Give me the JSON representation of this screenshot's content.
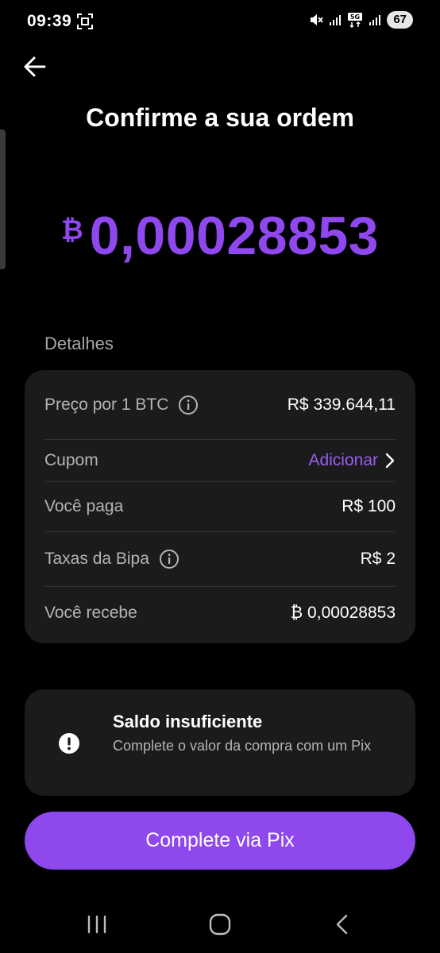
{
  "status_bar": {
    "time": "09:39",
    "battery": "67",
    "icons": [
      "screenshot-icon",
      "mute-icon",
      "signal-icon",
      "5g-icon",
      "signal-icon"
    ]
  },
  "header": {
    "back_icon": "arrow-left-icon",
    "title": "Confirme a sua ordem"
  },
  "amount": {
    "symbol": "₿",
    "value": "0,00028853"
  },
  "details": {
    "section_label": "Detalhes",
    "rows": [
      {
        "label": "Preço por 1 BTC",
        "value": "R$ 339.644,11",
        "has_info": true
      },
      {
        "label": "Cupom",
        "value": "Adicionar",
        "is_link": true
      },
      {
        "label": "Você paga",
        "value": "R$ 100"
      },
      {
        "label": "Taxas da Bipa",
        "value": "R$ 2",
        "has_info": true
      },
      {
        "label": "Você recebe",
        "value": "₿ 0,00028853"
      }
    ]
  },
  "alert": {
    "icon": "exclamation-circle-icon",
    "title": "Saldo insuficiente",
    "text": "Complete o valor da compra com um Pix"
  },
  "primary_button": {
    "label": "Complete via Pix"
  },
  "colors": {
    "accent": "#8f47ee",
    "background": "#000000",
    "card": "#1b1b1b"
  }
}
